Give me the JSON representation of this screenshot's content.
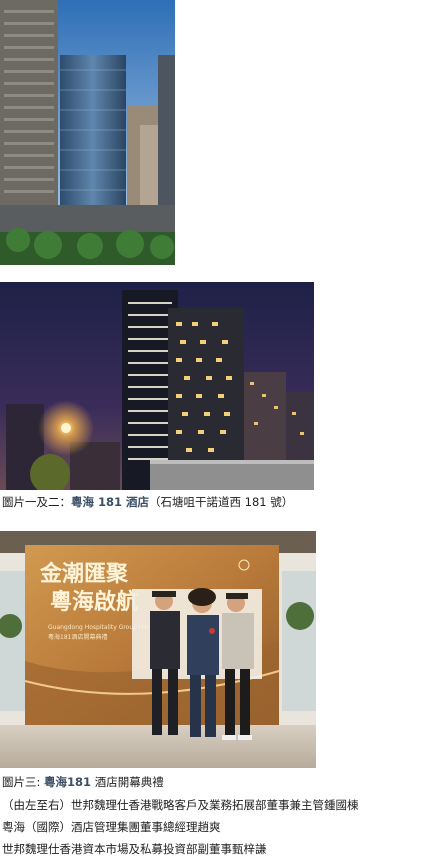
{
  "photos": {
    "one_alt": "",
    "two_alt": "",
    "three_alt": ""
  },
  "caption1": {
    "prefix": "圖片一及二：",
    "highlight": "粵海 181 酒店",
    "suffix": "（石塘咀干諾道西 181 號）"
  },
  "caption2": {
    "prefix": "圖片三: ",
    "highlight": "粵海181",
    "suffix": " 酒店開幕典禮"
  },
  "lines": [
    "（由左至右）世邦魏理仕香港戰略客戶及業務拓展部董事兼主管鍾國棟",
    "粵海（國際）酒店管理集團董事總經理趙爽",
    "世邦魏理仕香港資本市場及私募投資部副董事甄梓謙"
  ],
  "backdrop": {
    "title_line1": "金潮匯聚",
    "title_line2": "粵海啟航",
    "subtitle": "粵海181酒店開幕典禮",
    "subtitle_en": "Guangdong Hospitality Group Hotel"
  },
  "colors": {
    "accent_text": "#3b4f66",
    "backdrop_gold": "#c98a3a"
  }
}
